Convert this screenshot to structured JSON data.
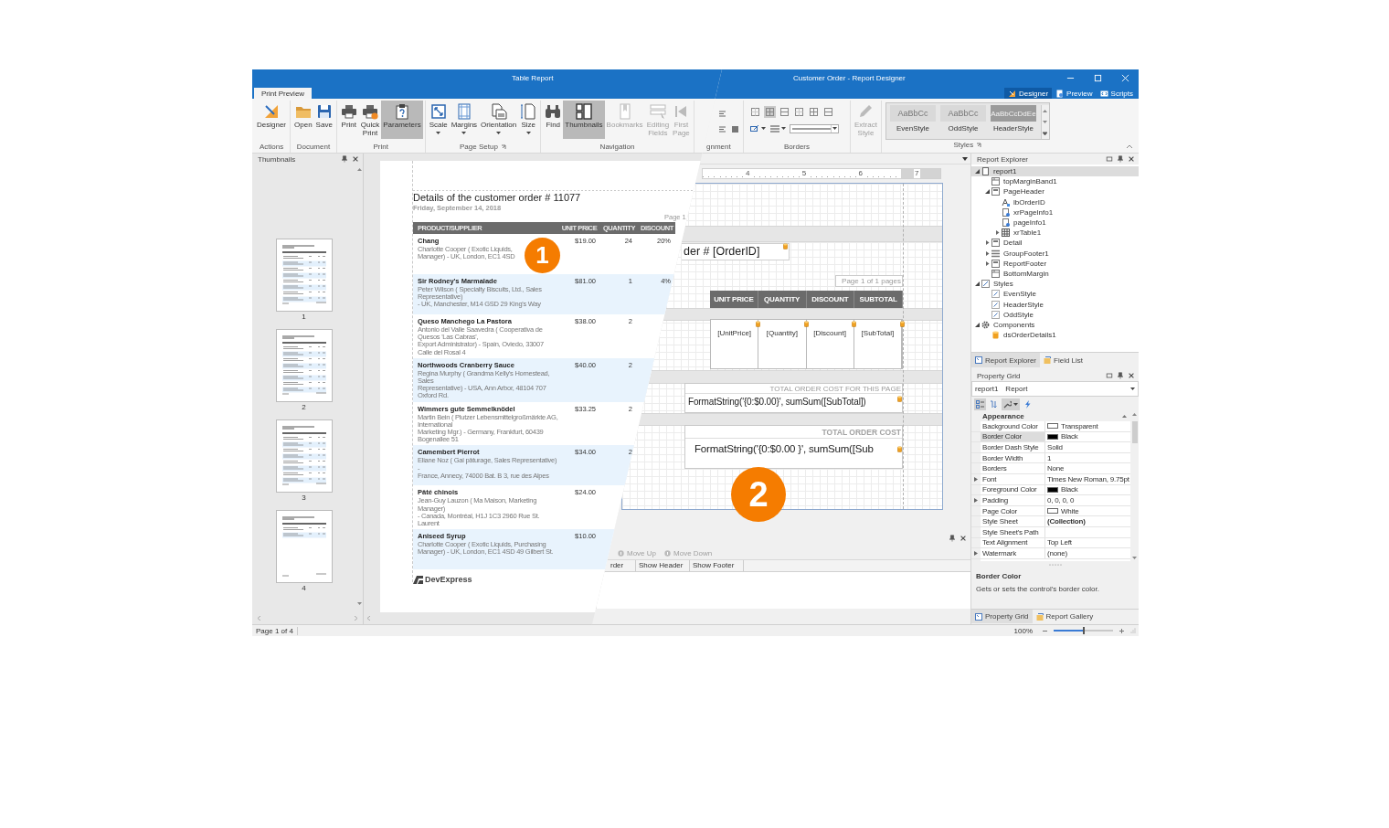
{
  "preview_window": {
    "title": "Table Report",
    "tabs": [
      {
        "label": "Print Preview",
        "selected": true
      }
    ],
    "ribbon": [
      {
        "label": "Actions",
        "launcher": false,
        "buttons": [
          {
            "label": "Designer",
            "pressed": false,
            "disabled": false,
            "dropdown": false
          }
        ]
      },
      {
        "label": "Document",
        "launcher": false,
        "buttons": [
          {
            "label": "Open",
            "pressed": false,
            "disabled": false,
            "dropdown": false
          },
          {
            "label": "Save",
            "pressed": false,
            "disabled": false,
            "dropdown": false
          }
        ]
      },
      {
        "label": "Print",
        "launcher": false,
        "buttons": [
          {
            "label": "Print",
            "pressed": false,
            "disabled": false,
            "dropdown": false
          },
          {
            "label": "Quick Print",
            "pressed": false,
            "disabled": false,
            "dropdown": false
          },
          {
            "label": "Parameters",
            "pressed": true,
            "disabled": false,
            "dropdown": false
          }
        ]
      },
      {
        "label": "Page Setup",
        "launcher": true,
        "buttons": [
          {
            "label": "Scale",
            "pressed": false,
            "disabled": false,
            "dropdown": true
          },
          {
            "label": "Margins",
            "pressed": false,
            "disabled": false,
            "dropdown": true
          },
          {
            "label": "Orientation",
            "pressed": false,
            "disabled": false,
            "dropdown": true
          },
          {
            "label": "Size",
            "pressed": false,
            "disabled": false,
            "dropdown": true
          }
        ]
      },
      {
        "label": "Navigation",
        "launcher": false,
        "buttons": [
          {
            "label": "Find",
            "pressed": false,
            "disabled": false,
            "dropdown": false
          },
          {
            "label": "Thumbnails",
            "pressed": true,
            "disabled": false,
            "dropdown": false
          },
          {
            "label": "Bookmarks",
            "pressed": false,
            "disabled": true,
            "dropdown": false
          },
          {
            "label": "Editing Fields",
            "pressed": false,
            "disabled": true,
            "dropdown": false
          },
          {
            "label": "First Page",
            "pressed": false,
            "disabled": true,
            "dropdown": false
          }
        ]
      }
    ],
    "thumbnails_panel": {
      "title": "Thumbnails",
      "pages": [
        {
          "label": "1"
        },
        {
          "label": "2"
        },
        {
          "label": "3"
        },
        {
          "label": "4"
        }
      ]
    },
    "document": {
      "title": "Details of the customer order # 11077",
      "date": "Friday, September 14, 2018",
      "page_label": "Page 1",
      "columns": [
        "PRODUCT/SUPPLIER",
        "UNIT PRICE",
        "QUANTITY",
        "DISCOUNT"
      ],
      "rows": [
        {
          "product": "Chang",
          "supplier_lines": [
            "Charlotte Cooper ( Exotic Liquids,",
            "Manager) - UK, London, EC1 4SD"
          ],
          "unit_price": "$19.00",
          "quantity": "24",
          "discount": "20%"
        },
        {
          "product": "Sir Rodney's Marmalade",
          "supplier_lines": [
            "Peter Wilson ( Specialty Biscuits, Ltd., Sales Representative)",
            "- UK, Manchester, M14 GSD  29 King's Way"
          ],
          "unit_price": "$81.00",
          "quantity": "1",
          "discount": "4%"
        },
        {
          "product": "Queso Manchego La Pastora",
          "supplier_lines": [
            "Antonio del Valle Saavedra ( Cooperativa de Quesos 'Las Cabras',",
            "Export Administrator) - Spain, Oviedo, 33007  Calle del Rosal 4"
          ],
          "unit_price": "$38.00",
          "quantity": "2"
        },
        {
          "product": "Northwoods Cranberry Sauce",
          "supplier_lines": [
            "Regina Murphy ( Grandma Kelly's Homestead, Sales",
            "Representative) - USA, Ann Arbor, 48104  707 Oxford Rd."
          ],
          "unit_price": "$40.00",
          "quantity": "2"
        },
        {
          "product": "Wimmers gute Semmelknödel",
          "supplier_lines": [
            "Martin Bein ( Plutzer Lebensmittelgroßmärkte AG, International",
            "Marketing Mgr.) - Germany, Frankfurt, 60439  Bogenallee 51"
          ],
          "unit_price": "$33.25",
          "quantity": "2"
        },
        {
          "product": "Camembert Pierrot",
          "supplier_lines": [
            "Eliane Noz ( Gai pâturage, Sales Representative) -",
            "France, Annecy, 74000  Bat. B 3, rue des Alpes"
          ],
          "unit_price": "$34.00",
          "quantity": "2"
        },
        {
          "product": "Pâté chinois",
          "supplier_lines": [
            "Jean-Guy Lauzon ( Ma Maison, Marketing Manager)",
            "- Canada, Montréal, H1J 1C3  2960 Rue St. Laurent"
          ],
          "unit_price": "$24.00"
        },
        {
          "product": "Aniseed Syrup",
          "supplier_lines": [
            "Charlotte Cooper ( Exotic Liquids, Purchasing",
            "Manager) - UK, London, EC1 4SD  49 Gilbert St."
          ],
          "unit_price": "$10.00"
        }
      ],
      "footer_logo": "DevExpress"
    },
    "status_bar": "Page 1 of 4",
    "callout": "1"
  },
  "designer_window": {
    "title": "Customer Order - Report Designer",
    "view_tabs": [
      {
        "label": "Designer",
        "selected": true
      },
      {
        "label": "Preview",
        "selected": false
      },
      {
        "label": "Scripts",
        "selected": false
      }
    ],
    "ribbon": {
      "alignment_label": "gnment",
      "borders_label": "Borders",
      "border_buttons": [
        {
          "pressed": false
        },
        {
          "pressed": true
        },
        {
          "pressed": false
        },
        {
          "pressed": false
        },
        {
          "pressed": false
        },
        {
          "pressed": false
        }
      ],
      "extract_style": {
        "label": "Extract Style",
        "disabled": true
      },
      "styles": [
        {
          "sample": "AaBbCc",
          "label": "EvenStyle",
          "kind": "light"
        },
        {
          "sample": "AaBbCc",
          "label": "OddStyle",
          "kind": "light"
        },
        {
          "sample": "AaBbCcDdEe",
          "label": "HeaderStyle",
          "kind": "dark"
        }
      ],
      "styles_label": "Styles"
    },
    "ruler": [
      "4",
      "5",
      "6",
      "7"
    ],
    "design_surface": {
      "order_label": "der # [OrderID]",
      "page_info": "Page 1 of 1 pages",
      "header_columns": [
        "UNIT PRICE",
        "QUANTITY",
        "DISCOUNT",
        "SUBTOTAL"
      ],
      "detail_cells": [
        "[UnitPrice]",
        "[Quantity]",
        "[Discount]",
        "[SubTotal]"
      ],
      "group_footer": {
        "caption": "TOTAL ORDER COST FOR THIS PAGE",
        "expression": "FormatString('{0:$0.00}', sumSum([SubTotal])"
      },
      "report_footer": {
        "caption": "TOTAL ORDER COST",
        "expression": "FormatString('{0:$0.00 }', sumSum([Sub"
      }
    },
    "callout": "2",
    "group_sort_panel": {
      "actions": [
        {
          "label": "Move Up",
          "disabled": true
        },
        {
          "label": "Move Down",
          "disabled": true
        }
      ],
      "columns": [
        "rder",
        "Show Header",
        "Show Footer"
      ]
    },
    "report_explorer": {
      "title": "Report Explorer",
      "tree": [
        {
          "label": "report1",
          "kind": "report",
          "selected": true,
          "expanded": true,
          "children": [
            {
              "label": "topMarginBand1",
              "kind": "band",
              "selected": false
            },
            {
              "label": "PageHeader",
              "kind": "header",
              "selected": false,
              "expanded": true,
              "children": [
                {
                  "label": "lbOrderID",
                  "kind": "label",
                  "selected": false
                },
                {
                  "label": "xrPageInfo1",
                  "kind": "pageinfo",
                  "selected": false
                },
                {
                  "label": "pageInfo1",
                  "kind": "pageinfo",
                  "selected": false
                },
                {
                  "label": "xrTable1",
                  "kind": "table",
                  "selected": false,
                  "expanded": false
                }
              ]
            },
            {
              "label": "Detail",
              "kind": "header",
              "selected": false,
              "expanded": false
            },
            {
              "label": "GroupFooter1",
              "kind": "group",
              "selected": false,
              "expanded": false
            },
            {
              "label": "ReportFooter",
              "kind": "header",
              "selected": false,
              "expanded": false
            },
            {
              "label": "BottomMargin",
              "kind": "band",
              "selected": false
            }
          ]
        },
        {
          "label": "Styles",
          "kind": "styles",
          "selected": false,
          "expanded": true,
          "children": [
            {
              "label": "EvenStyle",
              "kind": "style",
              "selected": false
            },
            {
              "label": "HeaderStyle",
              "kind": "style",
              "selected": false
            },
            {
              "label": "OddStyle",
              "kind": "style",
              "selected": false
            }
          ]
        },
        {
          "label": "Components",
          "kind": "components",
          "selected": false,
          "expanded": true,
          "children": [
            {
              "label": "dsOrderDetails1",
              "kind": "datasource",
              "selected": false
            }
          ]
        }
      ]
    },
    "explorer_tabs": [
      {
        "label": "Report Explorer",
        "selected": true
      },
      {
        "label": "Field List",
        "selected": false
      }
    ],
    "property_grid": {
      "title": "Property Grid",
      "object_name": "report1",
      "object_type": "Report",
      "toolbar": [
        {
          "pressed": true
        },
        {
          "pressed": false
        },
        {
          "pressed": true
        },
        {
          "pressed": false
        }
      ],
      "category": "Appearance",
      "properties": [
        {
          "name": "Background Color",
          "value": "Transparent",
          "kind": "color",
          "color": "#ffffff",
          "selected": false
        },
        {
          "name": "Border Color",
          "value": "Black",
          "kind": "color",
          "color": "#000000",
          "selected": true
        },
        {
          "name": "Border Dash Style",
          "value": "Solid",
          "kind": "text",
          "selected": false
        },
        {
          "name": "Border Width",
          "value": "1",
          "kind": "text",
          "selected": false
        },
        {
          "name": "Borders",
          "value": "None",
          "kind": "text",
          "selected": false
        },
        {
          "name": "Font",
          "value": "Times New Roman, 9.75pt",
          "kind": "nested",
          "selected": false
        },
        {
          "name": "Foreground Color",
          "value": "Black",
          "kind": "color",
          "color": "#000000",
          "selected": false
        },
        {
          "name": "Padding",
          "value": "0, 0, 0, 0",
          "kind": "nested",
          "selected": false
        },
        {
          "name": "Page Color",
          "value": "White",
          "kind": "color",
          "color": "#ffffff",
          "selected": false
        },
        {
          "name": "Style Sheet",
          "value": "(Collection)",
          "kind": "collection",
          "selected": false
        },
        {
          "name": "Style Sheet's Path",
          "kind": "text",
          "selected": false
        },
        {
          "name": "Text Alignment",
          "value": "Top Left",
          "kind": "text",
          "selected": false
        },
        {
          "name": "Watermark",
          "value": "(none)",
          "kind": "nested",
          "selected": false
        }
      ],
      "description": {
        "title": "Border Color",
        "text": "Gets or sets the control's border color."
      }
    },
    "panel_tabs": [
      {
        "label": "Property Grid",
        "selected": true
      },
      {
        "label": "Report Gallery",
        "selected": false
      }
    ],
    "zoom": {
      "label": "100%",
      "level": 0.5
    }
  }
}
